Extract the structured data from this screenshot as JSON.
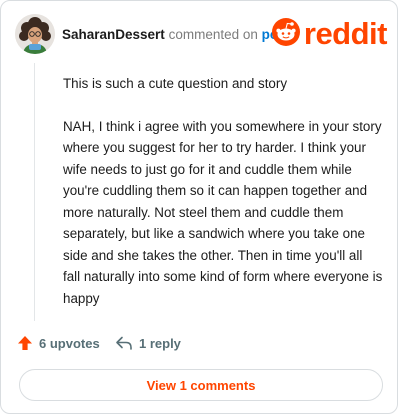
{
  "comment": {
    "username": "SaharanDessert",
    "action_text": "commented on",
    "target_link": "post",
    "paragraphs": [
      "This is such a cute question and story",
      "NAH, I think i agree with you somewhere in your story where you suggest for her to try harder. I think your wife needs to just go for it and cuddle them while you're cuddling them so it can happen together and more naturally. Not steel them and cuddle them separately, but like a sandwich where you take one side and she takes the other. Then in time you'll all fall naturally into some kind of form where everyone is happy"
    ],
    "upvotes_label": "6 upvotes",
    "replies_label": "1 reply"
  },
  "brand": {
    "wordmark": "reddit",
    "color": "#ff4500"
  },
  "footer": {
    "view_comments_label": "View 1 comments"
  },
  "icons": [
    "avatar",
    "reddit-logo-icon",
    "upvote-arrow-icon",
    "reply-icon"
  ]
}
